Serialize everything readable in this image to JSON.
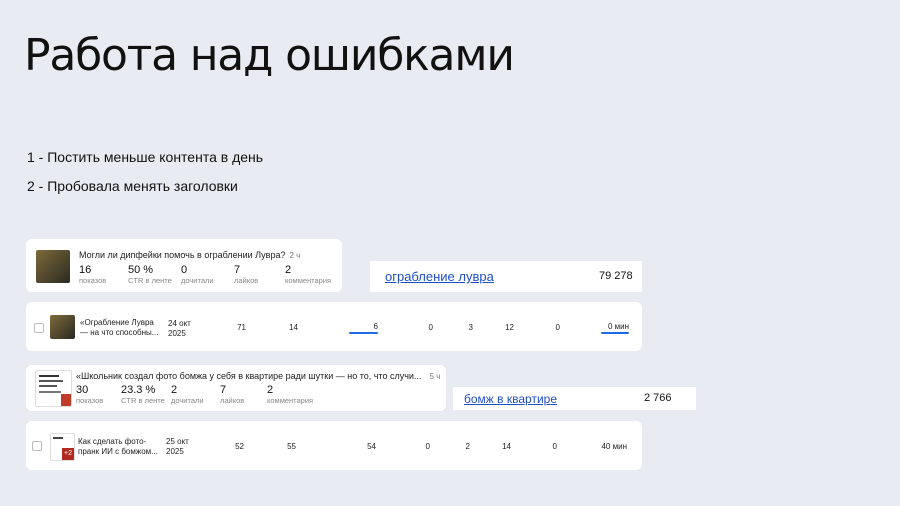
{
  "title": "Работа над ошибками",
  "points": [
    "1 - Постить меньше контента в день",
    "2 - Пробовала менять заголовки"
  ],
  "post1": {
    "title": "Могли ли дипфейки помочь в ограблении Лувра?",
    "age": "2 ч",
    "stats": [
      {
        "value": "16",
        "label": "показов"
      },
      {
        "value": "50 %",
        "label": "CTR в ленте"
      },
      {
        "value": "0",
        "label": "дочитали"
      },
      {
        "value": "7",
        "label": "лайков"
      },
      {
        "value": "2",
        "label": "комментария"
      }
    ]
  },
  "keyword1": {
    "text": "ограбление лувра",
    "count": "79 278"
  },
  "row1": {
    "title_line1": "«Ограбление Лувра",
    "title_line2": "— на что способны...",
    "date_line1": "24 окт",
    "date_line2": "2025",
    "cells": [
      "71",
      "14",
      "6",
      "0",
      "3",
      "12",
      "0",
      "0 мин"
    ],
    "bar_progress": [
      0.0,
      0.0,
      1.0,
      0.0,
      0.0,
      0.0,
      0.0,
      0.9
    ]
  },
  "post2": {
    "title": "«Школьник создал фото бомжа у себя в квартире ради шутки — но то, что случи...",
    "age": "5 ч",
    "stats": [
      {
        "value": "30",
        "label": "показов"
      },
      {
        "value": "23.3 %",
        "label": "CTR в ленте"
      },
      {
        "value": "2",
        "label": "дочитали"
      },
      {
        "value": "7",
        "label": "лайков"
      },
      {
        "value": "2",
        "label": "комментария"
      }
    ]
  },
  "keyword2": {
    "text": "бомж в квартире",
    "count": "2 766"
  },
  "row2": {
    "title_line1": "Как сделать фото-",
    "title_line2": "пранк ИИ с бомжом...",
    "date_line1": "25 окт",
    "date_line2": "2025",
    "thumb_badge": "+2",
    "cells": [
      "52",
      "55",
      "54",
      "0",
      "2",
      "14",
      "0",
      "40 мин"
    ]
  },
  "colors": {
    "background": "#e8ebf1",
    "link": "#1f4fc7",
    "bar": "#1f6be0"
  }
}
